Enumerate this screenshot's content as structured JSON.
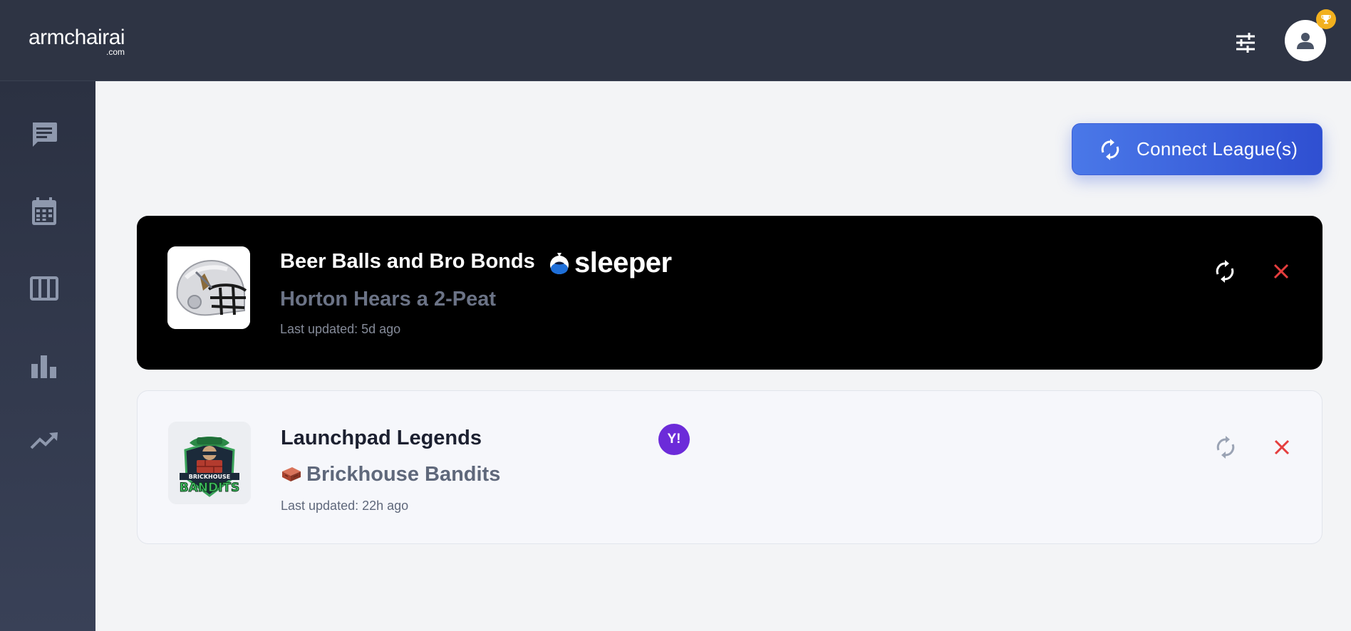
{
  "brand": {
    "name": "armchairai",
    "tld": ".com"
  },
  "header": {
    "settings_icon": "tune-icon",
    "avatar_icon": "user-icon",
    "badge_icon": "trophy-icon"
  },
  "sidebar": {
    "items": [
      {
        "icon": "chat-icon"
      },
      {
        "icon": "calendar-icon"
      },
      {
        "icon": "columns-icon"
      },
      {
        "icon": "bar-chart-icon"
      },
      {
        "icon": "trending-up-icon"
      }
    ]
  },
  "main": {
    "connect_button_label": "Connect League(s)",
    "leagues": [
      {
        "league_name": "Beer Balls and Bro Bonds",
        "platform": "sleeper",
        "team_name": "Horton Hears a 2-Peat",
        "last_updated": "Last updated: 5d ago",
        "theme": "dark"
      },
      {
        "league_name": "Launchpad Legends",
        "platform": "Y!",
        "team_name": "Brickhouse Bandits",
        "team_emoji": "🧱",
        "last_updated": "Last updated: 22h ago",
        "logo_text": [
          "BRICKHOUSE",
          "BANDITS"
        ],
        "theme": "light"
      }
    ]
  },
  "colors": {
    "header_bg": "#2e3444",
    "sidebar_bg": "#2b3142",
    "accent": "#3b5fdc",
    "remove": "#e53e3e",
    "yahoo": "#6c2bd9",
    "badge": "#f2b01e"
  }
}
